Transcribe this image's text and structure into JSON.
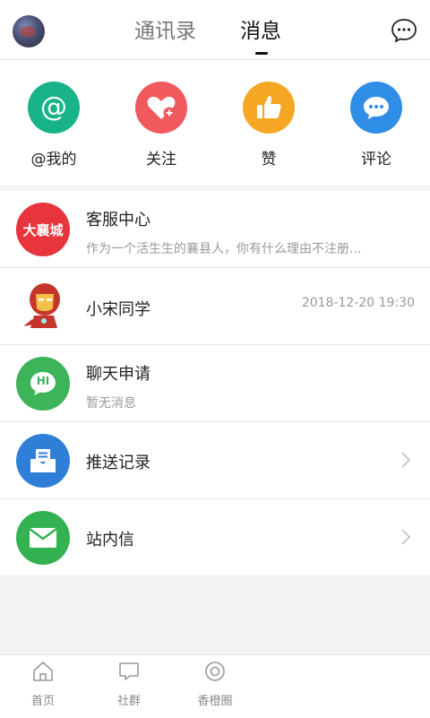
{
  "header": {
    "tabs": [
      {
        "label": "通讯录",
        "active": false
      },
      {
        "label": "消息",
        "active": true
      }
    ],
    "icons": {
      "avatar": "user-avatar",
      "right": "chat-bubble-icon"
    }
  },
  "quick_actions": [
    {
      "label": "@我的",
      "icon": "at-icon",
      "color": "#19b38a"
    },
    {
      "label": "关注",
      "icon": "heart-plus-icon",
      "color": "#f0595e"
    },
    {
      "label": "赞",
      "icon": "thumbs-up-icon",
      "color": "#f5a623"
    },
    {
      "label": "评论",
      "icon": "comment-icon",
      "color": "#2f8ee6"
    }
  ],
  "messages": [
    {
      "title": "客服中心",
      "subtitle": "作为一个活生生的襄县人，你有什么理由不注册...",
      "time": "",
      "icon": "daxiangcheng-logo",
      "icon_text": "大襄城",
      "color": "#e8343c"
    },
    {
      "title": "小宋同学",
      "subtitle": "",
      "time": "2018-12-20 19:30",
      "icon": "ironman-avatar",
      "color": "#c23a2a"
    },
    {
      "title": "聊天申请",
      "subtitle": "暂无消息",
      "time": "",
      "icon": "hi-chat-icon",
      "icon_text": "HI",
      "color": "#3db45a"
    },
    {
      "title": "推送记录",
      "subtitle": "",
      "time": "",
      "icon": "push-inbox-icon",
      "color": "#2f7fd8"
    },
    {
      "title": "站内信",
      "subtitle": "",
      "time": "",
      "icon": "envelope-icon",
      "color": "#34b150"
    }
  ],
  "bottom_nav": [
    {
      "label": "首页",
      "icon": "home-icon"
    },
    {
      "label": "社群",
      "icon": "community-chat-icon"
    },
    {
      "label": "香橙圈",
      "icon": "circle-icon"
    }
  ]
}
